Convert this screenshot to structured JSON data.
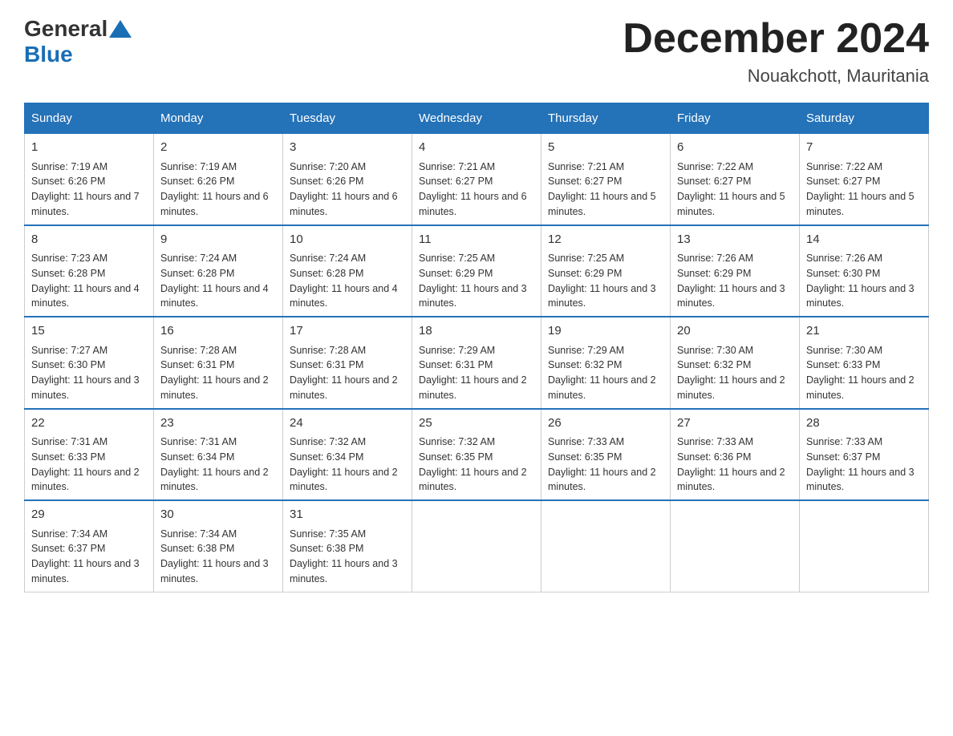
{
  "logo": {
    "text_general": "General",
    "text_blue": "Blue"
  },
  "header": {
    "title": "December 2024",
    "location": "Nouakchott, Mauritania"
  },
  "days_of_week": [
    "Sunday",
    "Monday",
    "Tuesday",
    "Wednesday",
    "Thursday",
    "Friday",
    "Saturday"
  ],
  "weeks": [
    [
      {
        "day": "1",
        "sunrise": "7:19 AM",
        "sunset": "6:26 PM",
        "daylight": "11 hours and 7 minutes."
      },
      {
        "day": "2",
        "sunrise": "7:19 AM",
        "sunset": "6:26 PM",
        "daylight": "11 hours and 6 minutes."
      },
      {
        "day": "3",
        "sunrise": "7:20 AM",
        "sunset": "6:26 PM",
        "daylight": "11 hours and 6 minutes."
      },
      {
        "day": "4",
        "sunrise": "7:21 AM",
        "sunset": "6:27 PM",
        "daylight": "11 hours and 6 minutes."
      },
      {
        "day": "5",
        "sunrise": "7:21 AM",
        "sunset": "6:27 PM",
        "daylight": "11 hours and 5 minutes."
      },
      {
        "day": "6",
        "sunrise": "7:22 AM",
        "sunset": "6:27 PM",
        "daylight": "11 hours and 5 minutes."
      },
      {
        "day": "7",
        "sunrise": "7:22 AM",
        "sunset": "6:27 PM",
        "daylight": "11 hours and 5 minutes."
      }
    ],
    [
      {
        "day": "8",
        "sunrise": "7:23 AM",
        "sunset": "6:28 PM",
        "daylight": "11 hours and 4 minutes."
      },
      {
        "day": "9",
        "sunrise": "7:24 AM",
        "sunset": "6:28 PM",
        "daylight": "11 hours and 4 minutes."
      },
      {
        "day": "10",
        "sunrise": "7:24 AM",
        "sunset": "6:28 PM",
        "daylight": "11 hours and 4 minutes."
      },
      {
        "day": "11",
        "sunrise": "7:25 AM",
        "sunset": "6:29 PM",
        "daylight": "11 hours and 3 minutes."
      },
      {
        "day": "12",
        "sunrise": "7:25 AM",
        "sunset": "6:29 PM",
        "daylight": "11 hours and 3 minutes."
      },
      {
        "day": "13",
        "sunrise": "7:26 AM",
        "sunset": "6:29 PM",
        "daylight": "11 hours and 3 minutes."
      },
      {
        "day": "14",
        "sunrise": "7:26 AM",
        "sunset": "6:30 PM",
        "daylight": "11 hours and 3 minutes."
      }
    ],
    [
      {
        "day": "15",
        "sunrise": "7:27 AM",
        "sunset": "6:30 PM",
        "daylight": "11 hours and 3 minutes."
      },
      {
        "day": "16",
        "sunrise": "7:28 AM",
        "sunset": "6:31 PM",
        "daylight": "11 hours and 2 minutes."
      },
      {
        "day": "17",
        "sunrise": "7:28 AM",
        "sunset": "6:31 PM",
        "daylight": "11 hours and 2 minutes."
      },
      {
        "day": "18",
        "sunrise": "7:29 AM",
        "sunset": "6:31 PM",
        "daylight": "11 hours and 2 minutes."
      },
      {
        "day": "19",
        "sunrise": "7:29 AM",
        "sunset": "6:32 PM",
        "daylight": "11 hours and 2 minutes."
      },
      {
        "day": "20",
        "sunrise": "7:30 AM",
        "sunset": "6:32 PM",
        "daylight": "11 hours and 2 minutes."
      },
      {
        "day": "21",
        "sunrise": "7:30 AM",
        "sunset": "6:33 PM",
        "daylight": "11 hours and 2 minutes."
      }
    ],
    [
      {
        "day": "22",
        "sunrise": "7:31 AM",
        "sunset": "6:33 PM",
        "daylight": "11 hours and 2 minutes."
      },
      {
        "day": "23",
        "sunrise": "7:31 AM",
        "sunset": "6:34 PM",
        "daylight": "11 hours and 2 minutes."
      },
      {
        "day": "24",
        "sunrise": "7:32 AM",
        "sunset": "6:34 PM",
        "daylight": "11 hours and 2 minutes."
      },
      {
        "day": "25",
        "sunrise": "7:32 AM",
        "sunset": "6:35 PM",
        "daylight": "11 hours and 2 minutes."
      },
      {
        "day": "26",
        "sunrise": "7:33 AM",
        "sunset": "6:35 PM",
        "daylight": "11 hours and 2 minutes."
      },
      {
        "day": "27",
        "sunrise": "7:33 AM",
        "sunset": "6:36 PM",
        "daylight": "11 hours and 2 minutes."
      },
      {
        "day": "28",
        "sunrise": "7:33 AM",
        "sunset": "6:37 PM",
        "daylight": "11 hours and 3 minutes."
      }
    ],
    [
      {
        "day": "29",
        "sunrise": "7:34 AM",
        "sunset": "6:37 PM",
        "daylight": "11 hours and 3 minutes."
      },
      {
        "day": "30",
        "sunrise": "7:34 AM",
        "sunset": "6:38 PM",
        "daylight": "11 hours and 3 minutes."
      },
      {
        "day": "31",
        "sunrise": "7:35 AM",
        "sunset": "6:38 PM",
        "daylight": "11 hours and 3 minutes."
      },
      null,
      null,
      null,
      null
    ]
  ]
}
